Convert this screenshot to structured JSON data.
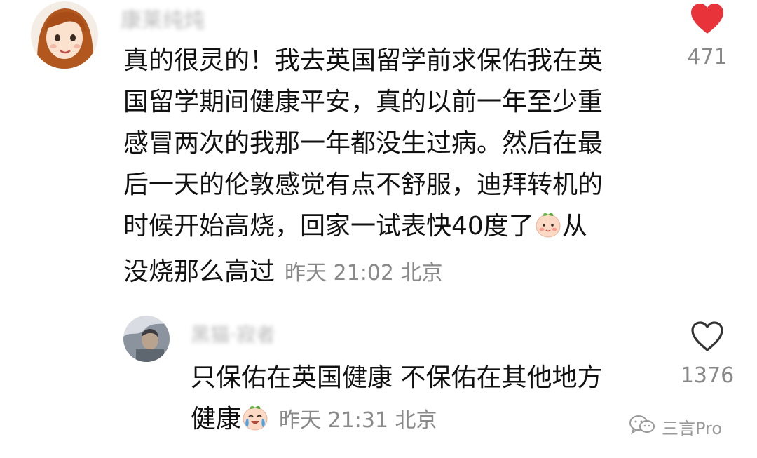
{
  "comments": [
    {
      "username": "康莱纯炖",
      "text_lines": [
        "真的很灵的！我去英国留学前求保佑我在英",
        "国留学期间健康平安，真的以前一年至少重",
        "感冒两次的我那一年都没生过病。然后在最",
        "后一天的伦敦感觉有点不舒服，迪拜转机的",
        "时候开始高烧，回家一试表快40度了"
      ],
      "last_line_after_emoji": "从",
      "final_line": "没烧那么高过",
      "timestamp": "昨天 21:02 北京",
      "likes": "471",
      "liked": true,
      "emoji": "blushing-peach-emoji",
      "like_color": "#e8333b"
    },
    {
      "username": "黑猫·寂者",
      "text_lines": [
        "只保佑在英国健康 不保佑在其他地方"
      ],
      "final_line": "健康",
      "timestamp": "昨天 21:31 北京",
      "likes": "1376",
      "liked": false,
      "emoji": "crying-laughing-peach-emoji"
    }
  ],
  "watermark": {
    "text": "三言Pro",
    "icon": "wechat-icon"
  }
}
